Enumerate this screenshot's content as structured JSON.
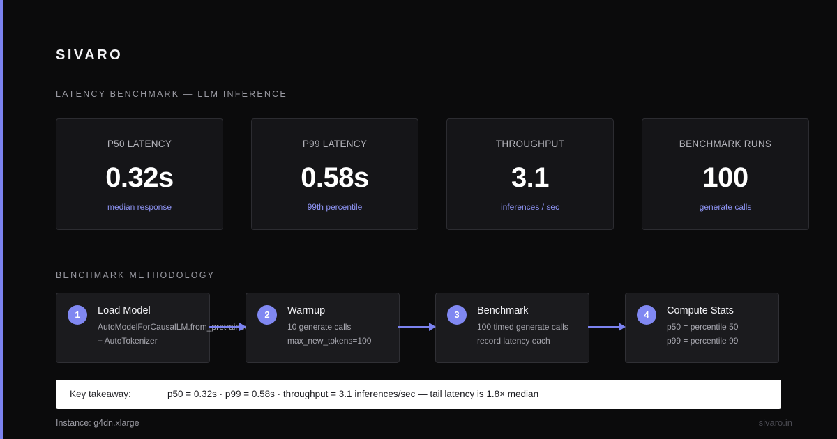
{
  "brand": "SIVARO",
  "accent_color": "#7b82f0",
  "section1_title": "LATENCY BENCHMARK — LLM INFERENCE",
  "metrics": [
    {
      "label": "P50 LATENCY",
      "value": "0.32s",
      "sub": "median response"
    },
    {
      "label": "P99 LATENCY",
      "value": "0.58s",
      "sub": "99th percentile"
    },
    {
      "label": "THROUGHPUT",
      "value": "3.1",
      "sub": "inferences / sec"
    },
    {
      "label": "BENCHMARK RUNS",
      "value": "100",
      "sub": "generate calls"
    }
  ],
  "section2_title": "BENCHMARK METHODOLOGY",
  "steps": [
    {
      "num": "1",
      "title": "Load Model",
      "line1": "AutoModelForCausalLM.from_pretrained",
      "line2": "+ AutoTokenizer"
    },
    {
      "num": "2",
      "title": "Warmup",
      "line1": "10 generate calls",
      "line2": "max_new_tokens=100"
    },
    {
      "num": "3",
      "title": "Benchmark",
      "line1": "100 timed generate calls",
      "line2": "record latency each"
    },
    {
      "num": "4",
      "title": "Compute Stats",
      "line1": "p50 = percentile 50",
      "line2": "p99 = percentile 99"
    }
  ],
  "takeaway": {
    "label": "Key takeaway:",
    "text": "p50 = 0.32s · p99 = 0.58s · throughput = 3.1 inferences/sec — tail latency is 1.8× median"
  },
  "instance": "Instance: g4dn.xlarge",
  "site": "sivaro.in"
}
